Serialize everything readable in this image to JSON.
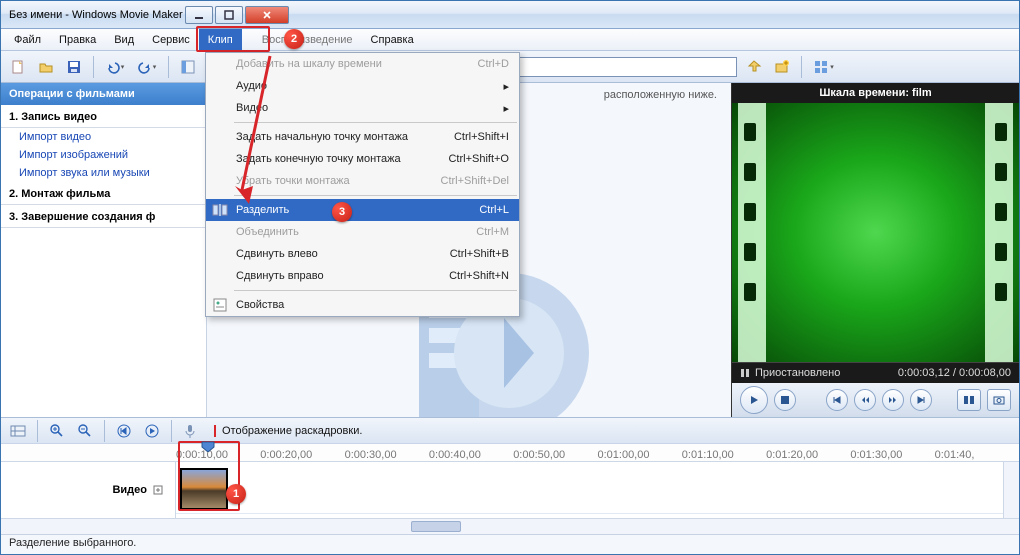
{
  "window": {
    "title": "Без имени - Windows Movie Maker"
  },
  "menubar": {
    "items": [
      "Файл",
      "Правка",
      "Вид",
      "Сервис",
      "Клип",
      "Воспроизведение",
      "Справка"
    ],
    "active_index": 4
  },
  "toolbar": {
    "tasks_label": "Операции",
    "empty_combo": ""
  },
  "dropdown": {
    "add_timeline": "Добавить на шкалу времени",
    "add_timeline_sc": "Ctrl+D",
    "audio": "Аудио",
    "video": "Видео",
    "set_start": "Задать начальную точку монтажа",
    "set_start_sc": "Ctrl+Shift+I",
    "set_end": "Задать конечную точку монтажа",
    "set_end_sc": "Ctrl+Shift+O",
    "clear_pts": "Убрать точки монтажа",
    "clear_pts_sc": "Ctrl+Shift+Del",
    "split": "Разделить",
    "split_sc": "Ctrl+L",
    "combine": "Объединить",
    "combine_sc": "Ctrl+M",
    "nudge_left": "Сдвинуть влево",
    "nudge_left_sc": "Ctrl+Shift+B",
    "nudge_right": "Сдвинуть вправо",
    "nudge_right_sc": "Ctrl+Shift+N",
    "properties": "Свойства"
  },
  "taskpane": {
    "header": "Операции с фильмами",
    "s1": "1. Запись видео",
    "l1": "Импорт видео",
    "l2": "Импорт изображений",
    "l3": "Импорт звука или музыки",
    "s2": "2. Монтаж фильма",
    "s3": "3. Завершение создания ф"
  },
  "center": {
    "hint_tail": "расположенную ниже."
  },
  "preview": {
    "title": "Шкала времени: film",
    "status": "Приостановлено",
    "time": "0:00:03,12 / 0:00:08,00"
  },
  "timeline": {
    "msg": "Отображение раскадровки.",
    "ruler": [
      "0:00:10,00",
      "0:00:20,00",
      "0:00:30,00",
      "0:00:40,00",
      "0:00:50,00",
      "0:01:00,00",
      "0:01:10,00",
      "0:01:20,00",
      "0:01:30,00",
      "0:01:40,"
    ],
    "video_label": "Видео"
  },
  "statusbar": {
    "text": "Разделение выбранного."
  },
  "callouts": {
    "c1": "1",
    "c2": "2",
    "c3": "3"
  }
}
